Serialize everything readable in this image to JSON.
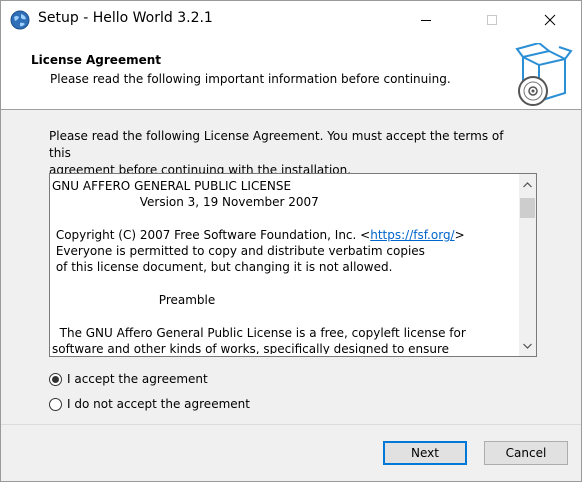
{
  "window": {
    "title": "Setup - Hello World 3.2.1"
  },
  "header": {
    "title": "License Agreement",
    "subtitle": "Please read the following important information before continuing."
  },
  "body": {
    "intro_line1": "Please read the following License Agreement. You must accept the terms of this",
    "intro_line2": "agreement before continuing with the installation."
  },
  "license": {
    "line1": "GNU AFFERO GENERAL PUBLIC LICENSE",
    "line2": "                       Version 3, 19 November 2007",
    "line3": "",
    "line4_prefix": " Copyright (C) 2007 Free Software Foundation, Inc. <",
    "line4_link": "https://fsf.org/",
    "line4_suffix": ">",
    "line5": " Everyone is permitted to copy and distribute verbatim copies",
    "line6": " of this license document, but changing it is not allowed.",
    "line7": "",
    "line8": "                            Preamble",
    "line9": "",
    "line10": "  The GNU Affero General Public License is a free, copyleft license for",
    "line11": "software and other kinds of works, specifically designed to ensure"
  },
  "options": {
    "accept_label": "I accept the agreement",
    "decline_label": "I do not accept the agreement",
    "selected": "accept"
  },
  "buttons": {
    "next_label": "Next",
    "cancel_label": "Cancel"
  },
  "icons": {
    "app": "globe-icon",
    "wizard": "box-with-disc-icon",
    "minimize": "minimize-icon",
    "maximize": "maximize-icon",
    "close": "close-icon"
  },
  "colors": {
    "accent": "#0078d7",
    "link": "#0066cc"
  }
}
